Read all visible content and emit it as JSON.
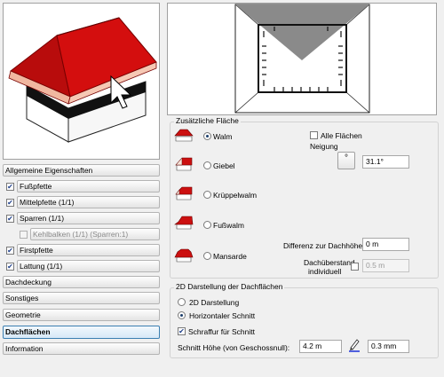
{
  "nav": {
    "items": [
      {
        "label": "Allgemeine Eigenschaften"
      },
      {
        "label": "Fußpfette",
        "checked": true
      },
      {
        "label": "Mittelpfette (1/1)",
        "checked": true
      },
      {
        "label": "Sparren (1/1)",
        "checked": true
      },
      {
        "label": "Kehlbalken (1/1) (Sparren:1)",
        "checked": false
      },
      {
        "label": "Firstpfette",
        "checked": true
      },
      {
        "label": "Lattung (1/1)",
        "checked": true
      },
      {
        "label": "Dachdeckung"
      },
      {
        "label": "Sonstiges"
      },
      {
        "label": "Geometrie"
      },
      {
        "label": "Dachflächen",
        "active": true
      },
      {
        "label": "Information"
      }
    ]
  },
  "zusatz": {
    "title": "Zusätzliche Fläche",
    "options": [
      {
        "label": "Walm",
        "selected": true
      },
      {
        "label": "Giebel",
        "selected": false
      },
      {
        "label": "Krüppelwalm",
        "selected": false
      },
      {
        "label": "Fußwalm",
        "selected": false
      },
      {
        "label": "Mansarde",
        "selected": false
      }
    ],
    "alle_flaechen_label": "Alle Flächen",
    "neigung_label": "Neigung",
    "degree_button": "°",
    "neigung_value": "31.1°",
    "differenz_label": "Differenz zur Dachhöhe",
    "differenz_value": "0 m",
    "ueberstand_label_1": "Dachüberstand",
    "ueberstand_label_2": "individuell",
    "ueberstand_value": "0.5 m"
  },
  "darstellung": {
    "title": "2D Darstellung der Dachflächen",
    "options": [
      {
        "label": "2D Darstellung",
        "selected": false
      },
      {
        "label": "Horizontaler Schnitt",
        "selected": true
      }
    ],
    "schraffur_label": "Schraffur für Schnitt",
    "schraffur_checked": true,
    "schnitt_label": "Schnitt Höhe (von Geschossnull):",
    "schnitt_value": "4.2 m",
    "pen_value": "0.3 mm"
  },
  "colors": {
    "roof_red": "#d40e0e",
    "selection_blue": "#3c7fb1"
  }
}
